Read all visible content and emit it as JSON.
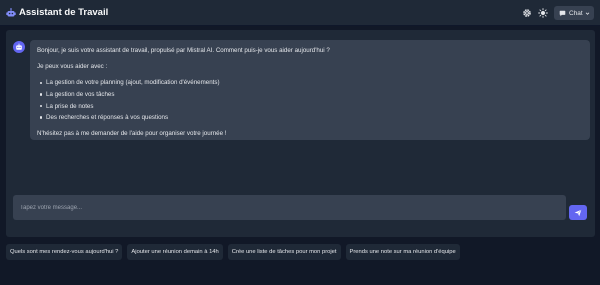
{
  "header": {
    "title": "Assistant de Travail",
    "chat_button_label": "Chat",
    "icons": [
      "robot-logo-icon",
      "gear-icon",
      "sun-icon",
      "chat-bubble-icon",
      "chevron-down-icon"
    ]
  },
  "conversation": {
    "assistant_message": {
      "greeting": "Bonjour, je suis votre assistant de travail, propulsé par Mistral AI. Comment puis-je vous aider aujourd'hui ?",
      "intro": "Je peux vous aider avec :",
      "items": [
        "La gestion de votre planning (ajout, modification d'événements)",
        "La gestion de vos tâches",
        "La prise de notes",
        "Des recherches et réponses à vos questions"
      ],
      "closing": "N'hésitez pas à me demander de l'aide pour organiser votre journée !"
    }
  },
  "composer": {
    "placeholder": "Tapez votre message...",
    "send_icon": "paper-plane-icon"
  },
  "suggestions": [
    "Quels sont mes rendez-vous aujourd'hui ?",
    "Ajouter une réunion demain à 14h",
    "Crée une liste de tâches pour mon projet",
    "Prends une note sur ma réunion d'équipe"
  ],
  "colors": {
    "background": "#111827",
    "panel": "#1f2937",
    "bubble": "#374151",
    "accent": "#6366f1"
  }
}
